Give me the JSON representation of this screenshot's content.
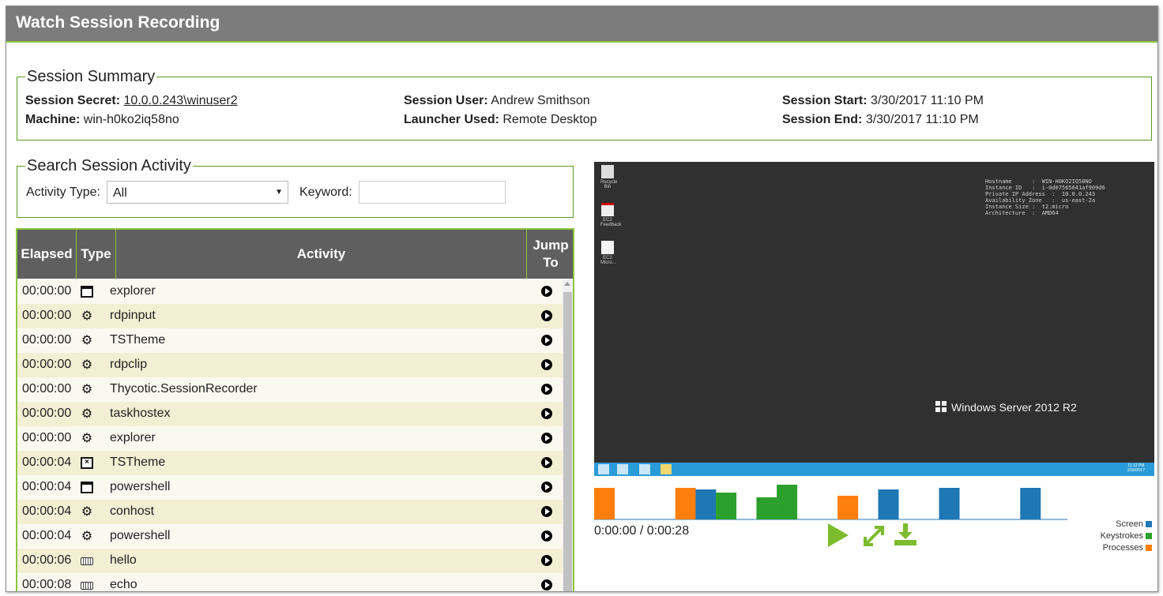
{
  "window": {
    "title": "Watch Session Recording"
  },
  "summary": {
    "legend": "Session Summary",
    "secret_label": "Session Secret:",
    "secret_value": "10.0.0.243\\winuser2",
    "machine_label": "Machine:",
    "machine_value": "win-h0ko2iq58no",
    "user_label": "Session User:",
    "user_value": "Andrew Smithson",
    "launcher_label": "Launcher Used:",
    "launcher_value": "Remote Desktop",
    "start_label": "Session Start:",
    "start_value": "3/30/2017 11:10 PM",
    "end_label": "Session End:",
    "end_value": "3/30/2017 11:10 PM"
  },
  "search": {
    "legend": "Search Session Activity",
    "activity_type_label": "Activity Type:",
    "activity_type_value": "All",
    "keyword_label": "Keyword:",
    "keyword_value": ""
  },
  "grid": {
    "headers": {
      "elapsed": "Elapsed",
      "type": "Type",
      "activity": "Activity",
      "jump": "Jump To"
    },
    "rows": [
      {
        "elapsed": "00:00:00",
        "type": "window-icon",
        "activity": "explorer"
      },
      {
        "elapsed": "00:00:00",
        "type": "gear-icon",
        "activity": "rdpinput"
      },
      {
        "elapsed": "00:00:00",
        "type": "gear-icon",
        "activity": "TSTheme"
      },
      {
        "elapsed": "00:00:00",
        "type": "gear-icon",
        "activity": "rdpclip"
      },
      {
        "elapsed": "00:00:00",
        "type": "gear-icon",
        "activity": "Thycotic.SessionRecorder"
      },
      {
        "elapsed": "00:00:00",
        "type": "gear-icon",
        "activity": "taskhostex"
      },
      {
        "elapsed": "00:00:00",
        "type": "gear-icon",
        "activity": "explorer"
      },
      {
        "elapsed": "00:00:04",
        "type": "close-window-icon",
        "activity": "TSTheme"
      },
      {
        "elapsed": "00:00:04",
        "type": "window-icon",
        "activity": "powershell"
      },
      {
        "elapsed": "00:00:04",
        "type": "gear-icon",
        "activity": "conhost"
      },
      {
        "elapsed": "00:00:04",
        "type": "gear-icon",
        "activity": "powershell"
      },
      {
        "elapsed": "00:00:06",
        "type": "keyboard-icon",
        "activity": "hello"
      },
      {
        "elapsed": "00:00:08",
        "type": "keyboard-icon",
        "activity": "echo"
      }
    ]
  },
  "player": {
    "desktop_icons": [
      "Recycle Bin",
      "EC2 Feedback",
      "EC2 Micro..."
    ],
    "bginfo_lines": [
      "Hostname      :  WIN-H0KO2IQ58NO",
      "Instance ID   :  i-0d07565641af909d6",
      "Private IP Address  :  10.0.0.243",
      "Availability Zone   :  us-east-2a",
      "Instance Size :  t2.micro",
      "Architecture  :  AMD64"
    ],
    "os_label": "Windows Server 2012 R2",
    "clock_time": "11:12 PM",
    "clock_date": "3/30/2017",
    "time_readout": "0:00:00 / 0:00:28",
    "colors": {
      "screen": "#1f77b4",
      "keystrokes": "#2ca02c",
      "processes": "#ff7f0e",
      "accent": "#7dbb2f"
    },
    "legend": {
      "screen": "Screen",
      "keystrokes": "Keystrokes",
      "processes": "Processes"
    },
    "timeline_bars": [
      {
        "series": "processes",
        "t": 0.0,
        "value": 1.0
      },
      {
        "series": "processes",
        "t": 4.0,
        "value": 1.0
      },
      {
        "series": "screen",
        "t": 5.0,
        "value": 0.95
      },
      {
        "series": "keystrokes",
        "t": 6.0,
        "value": 0.85
      },
      {
        "series": "keystrokes",
        "t": 8.0,
        "value": 0.7
      },
      {
        "series": "keystrokes",
        "t": 9.0,
        "value": 1.1
      },
      {
        "series": "processes",
        "t": 12.0,
        "value": 0.75
      },
      {
        "series": "screen",
        "t": 14.0,
        "value": 0.95
      },
      {
        "series": "screen",
        "t": 17.0,
        "value": 1.0
      },
      {
        "series": "screen",
        "t": 21.0,
        "value": 1.0
      }
    ]
  }
}
